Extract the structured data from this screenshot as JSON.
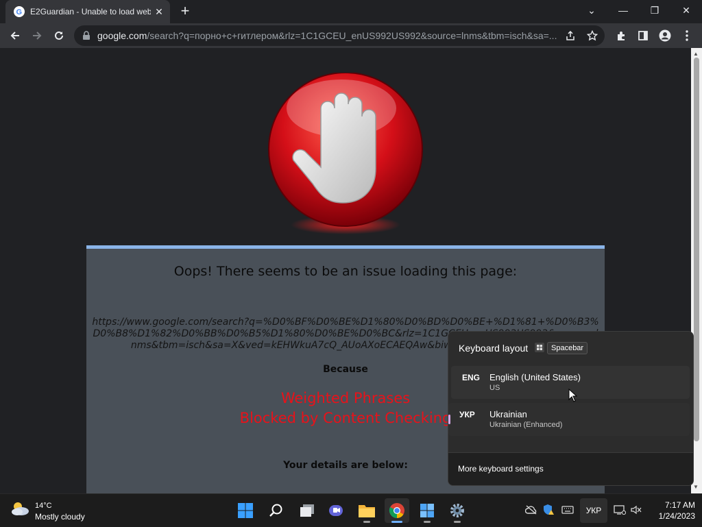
{
  "browser": {
    "tab": {
      "title": "E2Guardian - Unable to load web",
      "close_label": "✕"
    },
    "new_tab_label": "+",
    "window_controls": {
      "dropdown": "⌄",
      "minimize": "—",
      "restore": "❐",
      "close": "✕"
    },
    "url_host": "google.com",
    "url_rest": "/search?q=порно+с+гитлером&rlz=1C1GCEU_enUS992US992&source=lnms&tbm=isch&sa=..."
  },
  "page": {
    "headline": "Oops! There seems to be an issue loading this page:",
    "blocked_url": "https://www.google.com/search?q=%D0%BF%D0%BE%D1%80%D0%BD%D0%BE+%D1%81+%D0%B3%D0%B8%D1%82%D0%BB%D0%B5%D1%80%D0%BE%D0%BC&rlz=1C1GCEU_enUS992US992&source=lnms&tbm=isch&sa=X&ved=kEHWkuA7cQ_AUoAXoECAEQAw&biw=1024&bih=391&safe",
    "because": "Because",
    "reason_line1": "Weighted Phrases",
    "reason_line2": "Blocked by Content Checking",
    "details": "Your details are below:"
  },
  "keyboard_flyout": {
    "title": "Keyboard layout",
    "shortcut": "Spacebar",
    "languages": [
      {
        "code": "ENG",
        "name": "English (United States)",
        "layout": "US"
      },
      {
        "code": "УКР",
        "name": "Ukrainian",
        "layout": "Ukrainian (Enhanced)"
      }
    ],
    "more_settings": "More keyboard settings"
  },
  "taskbar": {
    "weather_temp": "14°C",
    "weather_condition": "Mostly cloudy",
    "input_language": "УКР",
    "time": "7:17 AM",
    "date": "1/24/2023"
  },
  "colors": {
    "accent": "#8ab4e8",
    "blocked_reason": "#e8121a",
    "stop_red": "#d40f18"
  }
}
